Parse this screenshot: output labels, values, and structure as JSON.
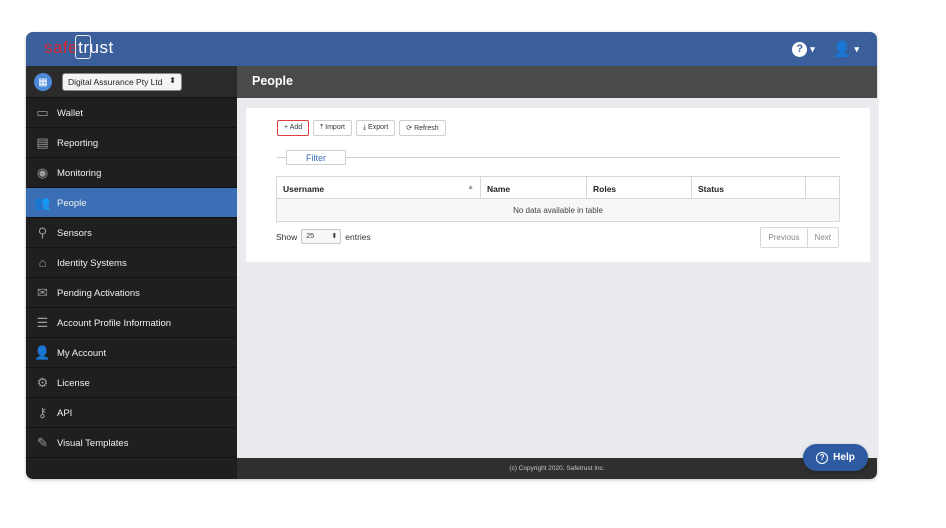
{
  "app": {
    "logo_part1": "safe",
    "logo_part2": "trust"
  },
  "header": {
    "help_icon": "question-circle-icon",
    "user_icon": "user-icon"
  },
  "sidebar": {
    "org_select": "Digital Assurance Pty Ltd",
    "items": [
      {
        "label": "Wallet",
        "icon": "wallet-icon",
        "active": false
      },
      {
        "label": "Reporting",
        "icon": "id-card-icon",
        "active": false
      },
      {
        "label": "Monitoring",
        "icon": "eye-icon",
        "active": false
      },
      {
        "label": "People",
        "icon": "users-icon",
        "active": true
      },
      {
        "label": "Sensors",
        "icon": "map-marker-icon",
        "active": false
      },
      {
        "label": "Identity Systems",
        "icon": "home-icon",
        "active": false
      },
      {
        "label": "Pending Activations",
        "icon": "envelope-icon",
        "active": false
      },
      {
        "label": "Account Profile Information",
        "icon": "list-icon",
        "active": false
      },
      {
        "label": "My Account",
        "icon": "user-icon",
        "active": false
      },
      {
        "label": "License",
        "icon": "gear-icon",
        "active": false
      },
      {
        "label": "API",
        "icon": "key-icon",
        "active": false
      },
      {
        "label": "Visual Templates",
        "icon": "brush-icon",
        "active": false
      }
    ]
  },
  "main": {
    "title": "People",
    "toolbar": {
      "add": "+ Add",
      "import": "⤒ Import",
      "export": "⤓ Export",
      "refresh": "⟳ Refresh"
    },
    "filter_label": "Filter",
    "table": {
      "columns": [
        "Username",
        "Name",
        "Roles",
        "Status",
        ""
      ],
      "empty_text": "No data available in table"
    },
    "show_label": "Show",
    "entries_value": "25",
    "entries_label": "entries",
    "pager": {
      "previous": "Previous",
      "next": "Next"
    }
  },
  "footer": {
    "text": "(c) Copyright 2020, Safetrust Inc."
  },
  "help_button": {
    "label": "Help"
  },
  "colors": {
    "topbar": "#3b5f9b",
    "active_nav": "#3b6fb5",
    "sidebar": "#1f1f1f",
    "accent_red": "#d7262d"
  }
}
